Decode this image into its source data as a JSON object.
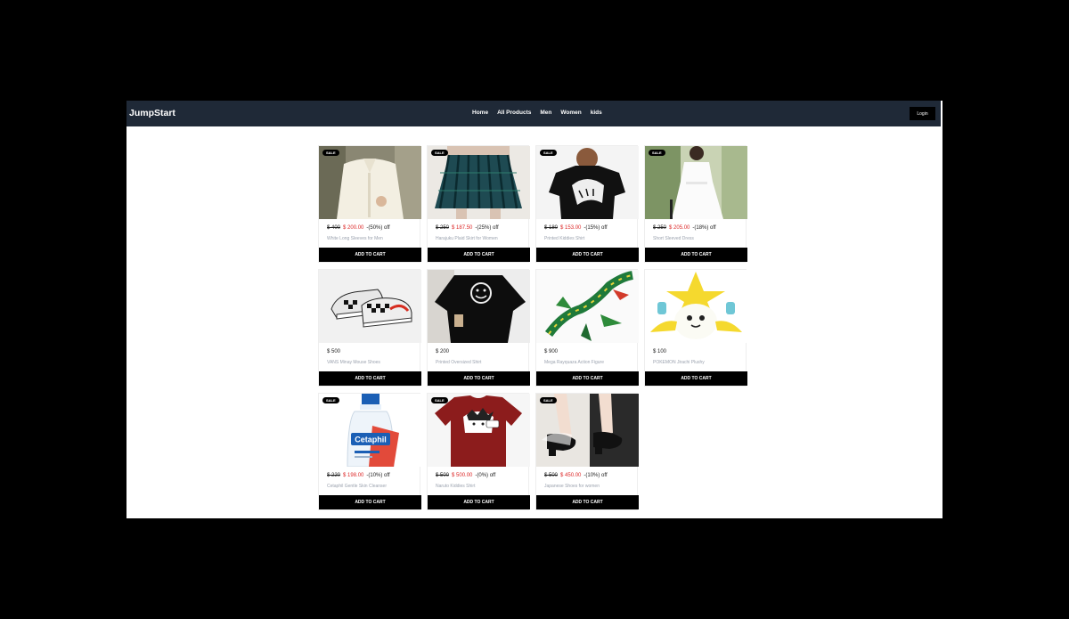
{
  "brand": "JumpStart",
  "nav": [
    "Home",
    "All Products",
    "Men",
    "Women",
    "kids"
  ],
  "login": "Login",
  "sale_label": "SALE",
  "cart_label": "ADD TO CART",
  "products": [
    {
      "name": "White Long Sleeves for Men",
      "sale": true,
      "old_price": "$ 400",
      "price": "$ 200.00",
      "discount": "-(50%) off"
    },
    {
      "name": "Harajuku Plaid Skirt for Women",
      "sale": true,
      "old_price": "$ 250",
      "price": "$ 187.50",
      "discount": "-(25%) off"
    },
    {
      "name": "Printed Kiddies Shirt",
      "sale": true,
      "old_price": "$ 180",
      "price": "$ 153.00",
      "discount": "-(15%) off"
    },
    {
      "name": "Short Sleeved Dress",
      "sale": true,
      "old_price": "$ 250",
      "price": "$ 205.00",
      "discount": "-(18%) off"
    },
    {
      "name": "VANS Minay Mouse Shoes",
      "sale": false,
      "price": "$ 500"
    },
    {
      "name": "Printed Oversized Shirt",
      "sale": false,
      "price": "$ 200"
    },
    {
      "name": "Mega Rayquaza Action Figure",
      "sale": false,
      "price": "$ 900"
    },
    {
      "name": "POKEMON Jirachi Plushy",
      "sale": false,
      "price": "$ 100"
    },
    {
      "name": "Cetaphil Gentle Skin Cleanser",
      "sale": true,
      "old_price": "$ 220",
      "price": "$ 198.00",
      "discount": "-(10%) off"
    },
    {
      "name": "Naruto Kiddies Shirt",
      "sale": true,
      "old_price": "$ 500",
      "price": "$ 500.00",
      "discount": "-(0%) off"
    },
    {
      "name": "Japanese Shoes for women",
      "sale": true,
      "old_price": "$ 500",
      "price": "$ 450.00",
      "discount": "-(10%) off"
    }
  ],
  "image_labels": {
    "cetaphil": "Cetaphil"
  },
  "colors": {
    "navbar": "#1f2937",
    "sale_price": "#dc2626",
    "button": "#000000"
  }
}
